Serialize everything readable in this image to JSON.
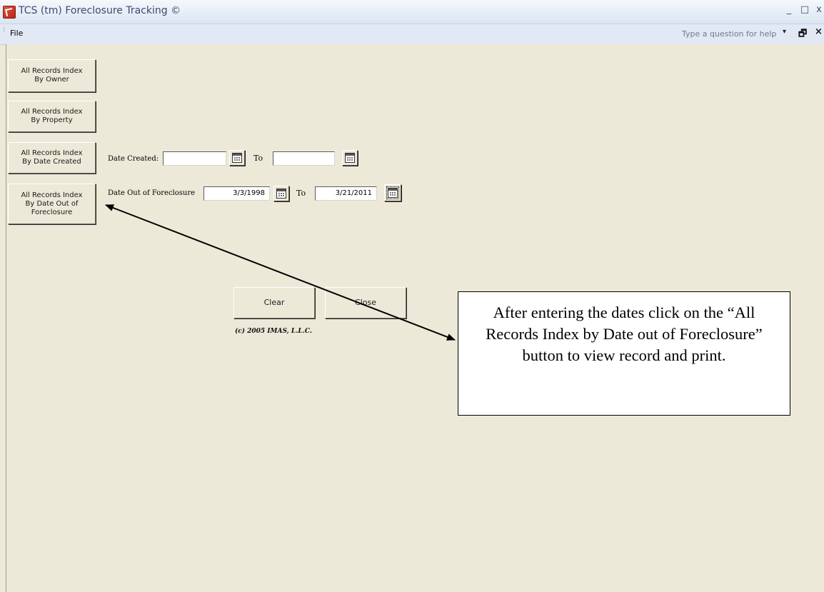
{
  "titlebar": {
    "title": "TCS (tm) Foreclosure Tracking ©",
    "minimize_glyph": "_",
    "maximize_glyph": "□",
    "close_glyph": "x"
  },
  "menubar": {
    "file_label": "File",
    "help_placeholder": "Type a question for help",
    "help_dropdown_glyph": "▾",
    "restore_glyph": "🗗",
    "close_glyph": "×"
  },
  "form": {
    "buttons": {
      "by_owner": "All Records Index\nBy Owner",
      "by_property": "All Records Index\nBy Property",
      "by_date_created": "All Records Index\nBy Date Created",
      "by_date_out": "All Records Index\nBy Date Out of\nForeclosure",
      "clear": "Clear",
      "close": "Close"
    },
    "date_created": {
      "label": "Date Created:",
      "to_label": "To",
      "from_value": "",
      "to_value": ""
    },
    "date_out": {
      "label": "Date Out of Foreclosure",
      "to_label": "To",
      "from_value": "3/3/1998",
      "to_value": "3/21/2011"
    },
    "copyright": "(c) 2005 IMAS, L.L.C."
  },
  "callout": {
    "text": "After entering the dates click on the “All Records Index by Date out of Foreclosure” button to view record and print."
  },
  "icons": {
    "app": "access-app-icon",
    "calendar": "calendar-icon"
  },
  "colors": {
    "form_background": "#ece9d8",
    "titlebar_text": "#3b4a73",
    "menubar_background": "#e3e9f4"
  }
}
